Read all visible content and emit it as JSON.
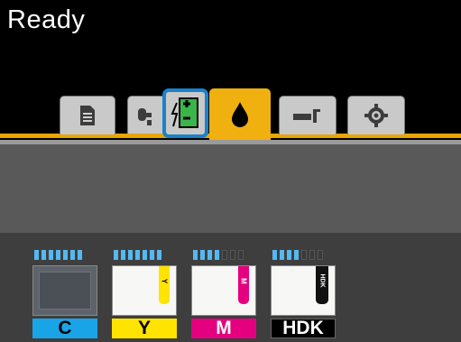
{
  "status": {
    "text": "Ready"
  },
  "tabs": [
    {
      "id": "print-queue",
      "icon": "document-list-icon"
    },
    {
      "id": "paper",
      "icon": "paper-roll-icon"
    },
    {
      "id": "paper-adjust",
      "icon": "paper-adjust-icon",
      "highlighted": true
    },
    {
      "id": "ink",
      "icon": "ink-drop-icon",
      "active": true
    },
    {
      "id": "maintenance",
      "icon": "wrench-icon"
    },
    {
      "id": "setup",
      "icon": "gear-icon"
    }
  ],
  "colors": {
    "accent": "#f0b010",
    "level": "#56b8f0",
    "cyan": "#1aa4e8",
    "yellow": "#ffe400",
    "magenta": "#e4007f",
    "hdk": "#000000",
    "highlight_box": "#1a82c8"
  },
  "inks": [
    {
      "name": "C",
      "level": 0.9,
      "label_color": "#1aa4e8",
      "label_text_color": "#000000",
      "stripe_color": ""
    },
    {
      "name": "Y",
      "level": 1.0,
      "label_color": "#ffe400",
      "label_text_color": "#000000",
      "stripe_color": "#ffe400",
      "stripe_text": "Y"
    },
    {
      "name": "M",
      "level": 0.6,
      "label_color": "#e4007f",
      "label_text_color": "#ffffff",
      "stripe_color": "#e4007f",
      "stripe_text": "M"
    },
    {
      "name": "HDK",
      "level": 0.6,
      "label_color": "#000000",
      "label_text_color": "#ffffff",
      "stripe_color": "#111111",
      "stripe_text": "HDK"
    }
  ]
}
